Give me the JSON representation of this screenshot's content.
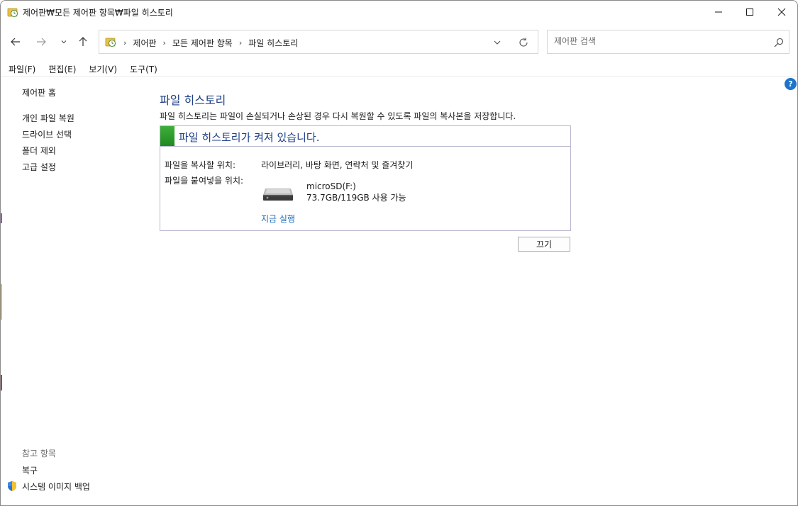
{
  "window": {
    "title": "제어판₩모든 제어판 항목₩파일 히스토리"
  },
  "titlebar": {
    "icon": "file-history-icon",
    "controls": [
      "minimize-icon",
      "maximize-icon",
      "close-icon"
    ]
  },
  "navigation": {
    "breadcrumbs": [
      "제어판",
      "모든 제어판 항목",
      "파일 히스토리"
    ],
    "search_placeholder": "제어판 검색"
  },
  "menubar": {
    "items": [
      "파일(F)",
      "편집(E)",
      "보기(V)",
      "도구(T)"
    ]
  },
  "leftpane": {
    "home": "제어판 홈",
    "links": [
      "개인 파일 복원",
      "드라이브 선택",
      "폴더 제외",
      "고급 설정"
    ],
    "see_also_title": "참고 항목",
    "see_also": [
      "복구",
      "시스템 이미지 백업"
    ]
  },
  "content": {
    "title": "파일 히스토리",
    "description": "파일 히스토리는 파일이 손실되거나 손상된 경우 다시 복원할 수 있도록 파일의 복사본을 저장합니다.",
    "status": "파일 히스토리가 켜져 있습니다.",
    "copy_from_label": "파일을 복사할 위치:",
    "copy_from_value": "라이브러리, 바탕 화면, 연락처 및 즐겨찾기",
    "copy_to_label": "파일을 붙여넣을 위치:",
    "drive_name": "microSD(F:)",
    "drive_space": "73.7GB/119GB 사용 가능",
    "run_now": "지금 실행",
    "off_button": "끄기"
  },
  "colors": {
    "title_blue": "#1e3f86",
    "link_blue": "#1e6bb8",
    "status_green": "#2e9e2f",
    "help_blue": "#1e73c9"
  }
}
